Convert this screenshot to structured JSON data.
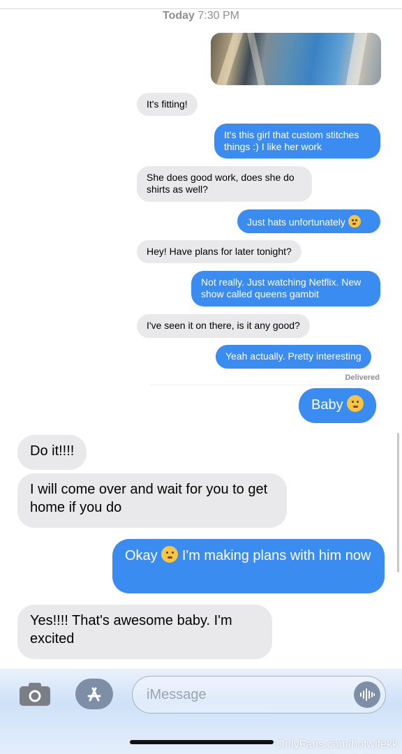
{
  "header": {
    "day": "Today",
    "time": "7:30 PM"
  },
  "messages": [
    {
      "dir": "in",
      "text": "It's fitting!"
    },
    {
      "dir": "out",
      "text": "It's this girl that custom stitches things :) I like her work"
    },
    {
      "dir": "in",
      "text": "She does good work, does she do shirts as well?"
    },
    {
      "dir": "out",
      "text": "Just hats unfortunately",
      "emoji": "weary-face"
    },
    {
      "dir": "in",
      "text": "Hey! Have plans for later tonight?"
    },
    {
      "dir": "out",
      "text": "Not really. Just watching Netflix. New show called queens gambit"
    },
    {
      "dir": "in",
      "text": "I've seen it on there, is it any good?"
    },
    {
      "dir": "out",
      "text": "Yeah actually. Pretty interesting"
    },
    {
      "dir": "out",
      "text": "Baby",
      "emoji": "flushed-face"
    },
    {
      "dir": "in",
      "text": "Do it!!!!"
    },
    {
      "dir": "in",
      "text": "I will come over and wait for you to get home if you do"
    },
    {
      "dir": "out",
      "text_a": "Okay",
      "text_b": "I'm making plans with him now",
      "emoji": "relieved-face"
    },
    {
      "dir": "in",
      "text": "Yes!!!! That's awesome baby. I'm excited"
    }
  ],
  "status": {
    "delivered": "Delivered"
  },
  "compose": {
    "placeholder": "iMessage"
  },
  "icons": {
    "camera": "camera-icon",
    "apps": "app-store-icon",
    "audio": "audio-waveform-icon"
  },
  "colors": {
    "outgoing": "#3b8cf0",
    "incoming": "#e9e9eb"
  },
  "watermark": "OnlyFans.com/hotwifekk"
}
